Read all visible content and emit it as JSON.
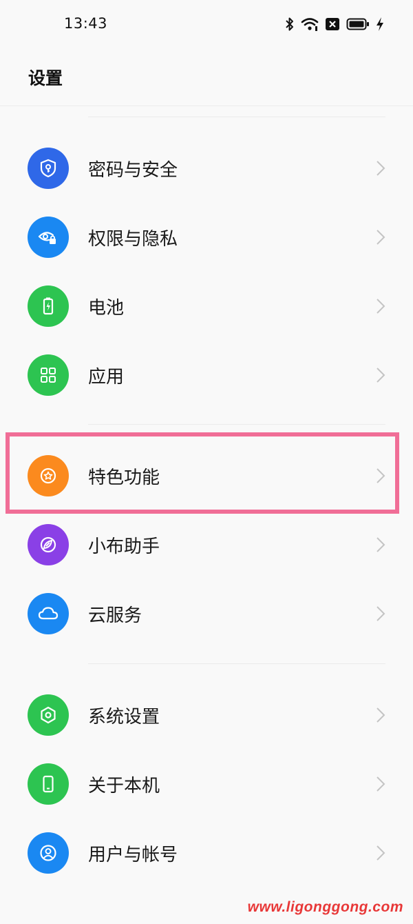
{
  "status_bar": {
    "time": "13:43",
    "icons": [
      "bluetooth-icon",
      "wifi-icon",
      "notification-x-icon",
      "battery-icon",
      "charging-icon"
    ]
  },
  "header": {
    "title": "设置"
  },
  "settings_groups": [
    {
      "items": [
        {
          "label": "密码与安全",
          "icon": "shield-key-icon",
          "color": "#2f68e8"
        },
        {
          "label": "权限与隐私",
          "icon": "eye-lock-icon",
          "color": "#1a88f2"
        },
        {
          "label": "电池",
          "icon": "battery-charging-icon",
          "color": "#2dc451"
        },
        {
          "label": "应用",
          "icon": "app-grid-icon",
          "color": "#2dc451"
        }
      ]
    },
    {
      "items": [
        {
          "label": "特色功能",
          "icon": "star-badge-icon",
          "color": "#fb8a1e",
          "highlighted": true
        },
        {
          "label": "小布助手",
          "icon": "assistant-icon",
          "color": "#8a40e6"
        },
        {
          "label": "云服务",
          "icon": "cloud-icon",
          "color": "#1a88f2"
        }
      ]
    },
    {
      "items": [
        {
          "label": "系统设置",
          "icon": "hexagon-gear-icon",
          "color": "#2dc451"
        },
        {
          "label": "关于本机",
          "icon": "phone-icon",
          "color": "#2dc451"
        },
        {
          "label": "用户与帐号",
          "icon": "user-icon",
          "color": "#1a88f2"
        }
      ]
    }
  ],
  "highlight_color": "#f06e97",
  "watermark": "www.ligonggong.com"
}
